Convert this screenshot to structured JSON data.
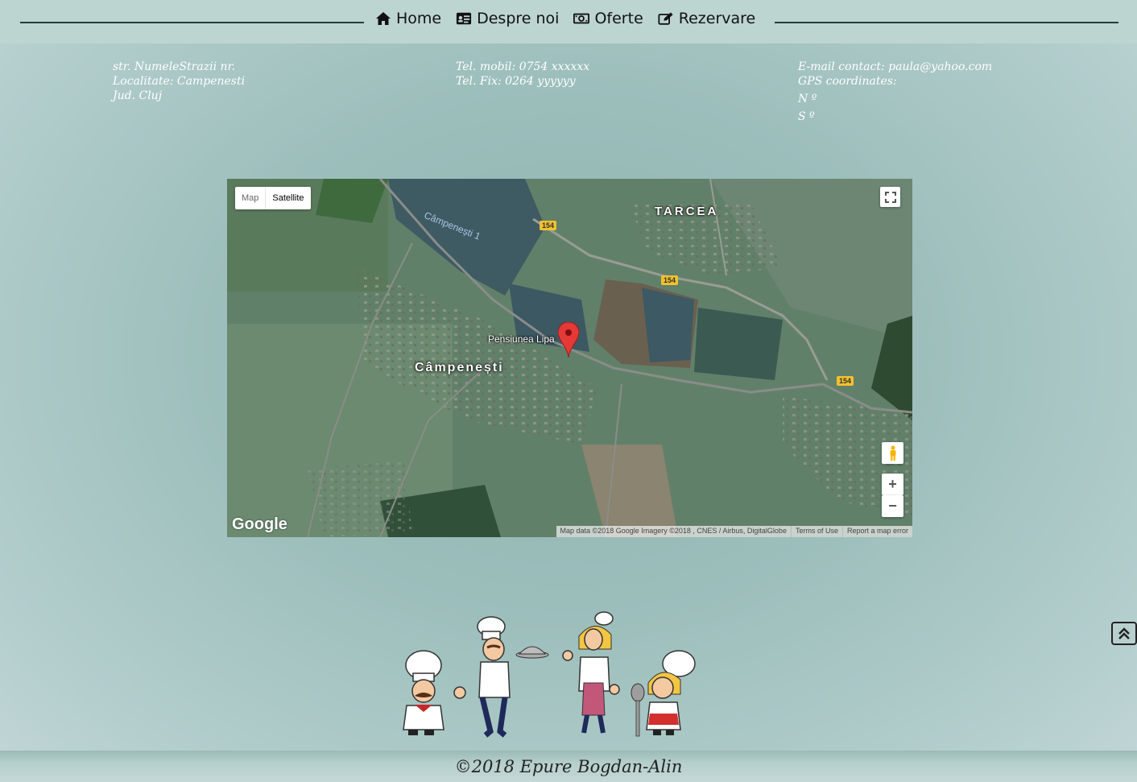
{
  "nav": {
    "items": [
      {
        "label": "Home",
        "icon": "home-icon"
      },
      {
        "label": "Despre noi",
        "icon": "id-card-icon"
      },
      {
        "label": "Oferte",
        "icon": "money-bill-icon"
      },
      {
        "label": "Rezervare",
        "icon": "edit-icon"
      }
    ]
  },
  "contact": {
    "address": [
      "str. NumeleStrazii nr.",
      "Localitate: Campenesti",
      "Jud. Cluj"
    ],
    "phones": [
      "Tel. mobil: 0754 xxxxxx",
      "Tel. Fix: 0264 yyyyyy"
    ],
    "email": "E-mail contact: paula@yahoo.com",
    "gps_label": "GPS coordinates:",
    "gps_n": "N º",
    "gps_s": "S º"
  },
  "map": {
    "type_map": "Map",
    "type_satellite": "Satellite",
    "selected_type": "Satellite",
    "labels": {
      "town_main": "Câmpenești",
      "town_north": "TARCEA",
      "lake": "Câmpenești 1",
      "poi": "Pensiunea Lipa",
      "road": "154"
    },
    "logo": "Google",
    "attribution": "Map data ©2018 Google Imagery ©2018 , CNES / Airbus, DigitalGlobe",
    "terms": "Terms of Use",
    "report": "Report a map error",
    "zoom_in": "+",
    "zoom_out": "−"
  },
  "footer": {
    "copyright": "©2018 Epure Bogdan-Alin"
  },
  "colors": {
    "nav_bg": "#bdd5d1",
    "text_dark": "#111111",
    "contact_text": "#ffffff"
  }
}
